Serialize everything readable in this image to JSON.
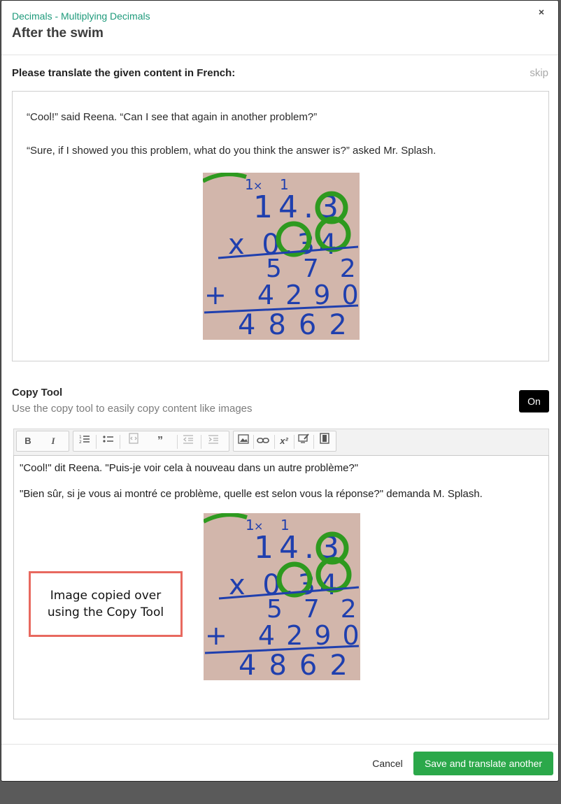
{
  "header": {
    "breadcrumb": "Decimals - Multiplying Decimals",
    "title": "After the swim",
    "close_label": "×"
  },
  "prompt": {
    "text": "Please translate the given content in French:",
    "skip_label": "skip"
  },
  "source": {
    "paragraph_1": "“Cool!” said Reena. “Can I see that again in another problem?”",
    "paragraph_2": "“Sure, if I showed you this problem, what do you think the answer is?” asked Mr. Splash."
  },
  "math_image": {
    "carry_1": "1",
    "carry_2": "1",
    "top_number": "14.3",
    "multiplier": "x 0.34",
    "partial_1": "572",
    "partial_2": "+ 4290",
    "result": "4862"
  },
  "copy_tool": {
    "title": "Copy Tool",
    "description": "Use the copy tool to easily copy content like images",
    "toggle_label": "On"
  },
  "toolbar": {
    "bold_icon": "bold-icon",
    "italic_icon": "italic-icon",
    "ordered_list_icon": "ordered-list-icon",
    "bulleted_list_icon": "bulleted-list-icon",
    "source_icon": "source-icon",
    "quote_icon": "quote-icon",
    "outdent_icon": "outdent-icon",
    "indent_icon": "indent-icon",
    "image_icon": "image-icon",
    "link_icon": "link-icon",
    "superscript_icon": "superscript-icon",
    "paint_icon": "paint-icon",
    "video_icon": "video-icon"
  },
  "editor": {
    "paragraph_1": "\"Cool!\" dit Reena. \"Puis-je voir cela à nouveau dans un autre problème?\"",
    "paragraph_2": "\"Bien sûr, si je vous ai montré ce problème, quelle est selon vous la réponse?\" demanda M. Splash."
  },
  "annotation": {
    "line_1": "Image copied over",
    "line_2": "using the Copy Tool"
  },
  "footer": {
    "cancel_label": "Cancel",
    "save_label": "Save and translate another"
  },
  "colors": {
    "accent": "#1e9a7b",
    "save_button": "#2ba84a",
    "annotation_border": "#e8695f",
    "ink_blue": "#1f3fae",
    "ink_green": "#2e9a1f"
  }
}
